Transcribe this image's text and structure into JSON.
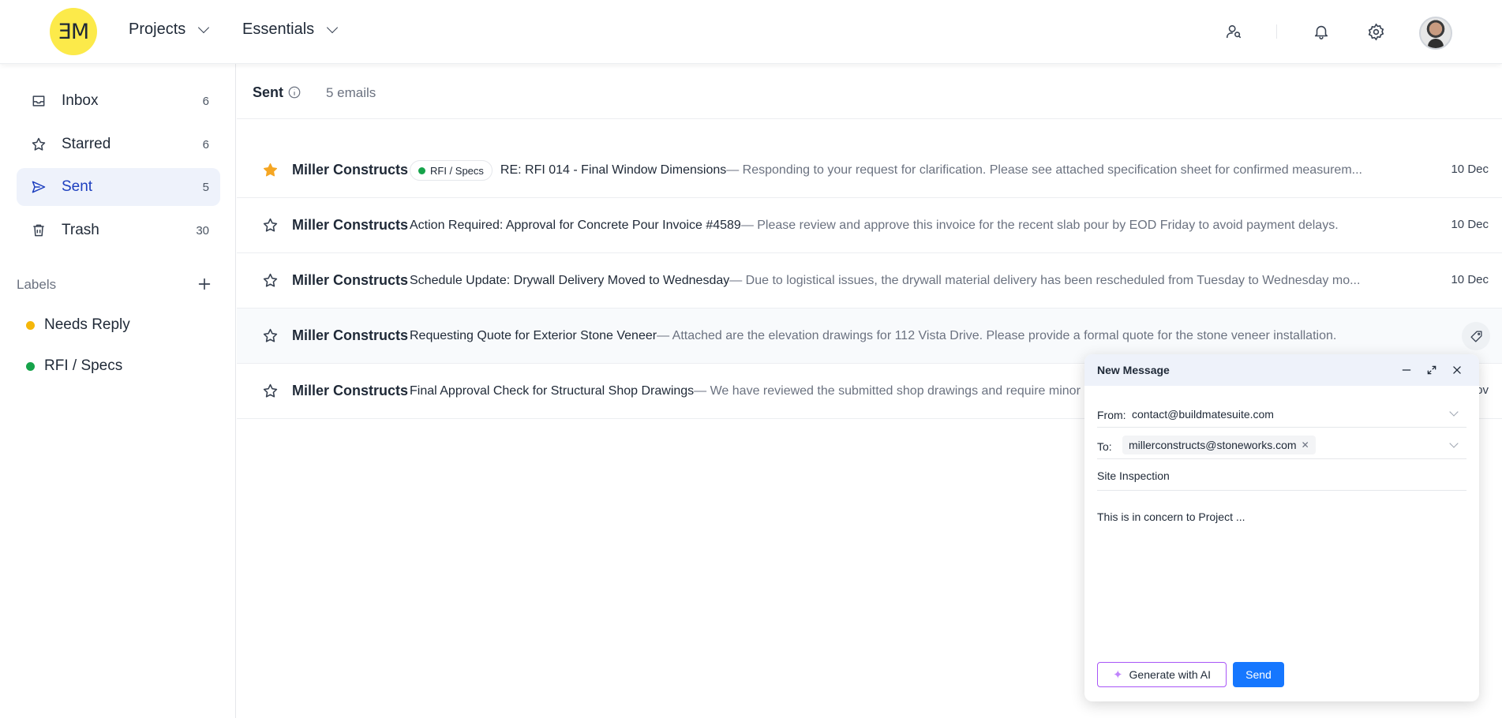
{
  "header": {
    "logo_text": "ƎM",
    "nav": [
      {
        "label": "Projects"
      },
      {
        "label": "Essentials"
      }
    ]
  },
  "sidebar": {
    "items": [
      {
        "label": "Inbox",
        "count": "6",
        "icon": "inbox-icon"
      },
      {
        "label": "Starred",
        "count": "6",
        "icon": "star-icon"
      },
      {
        "label": "Sent",
        "count": "5",
        "icon": "send-icon",
        "active": true
      },
      {
        "label": "Trash",
        "count": "30",
        "icon": "trash-icon"
      }
    ],
    "labels_heading": "Labels",
    "labels": [
      {
        "label": "Needs Reply",
        "color": "#f5b70a"
      },
      {
        "label": "RFI / Specs",
        "color": "#16a34a"
      }
    ]
  },
  "main": {
    "title": "Sent",
    "count_text": "5 emails",
    "emails": [
      {
        "sender": "Miller Constructs",
        "starred": true,
        "tag": "RFI / Specs",
        "tag_color": "#16a34a",
        "subject": "RE: RFI 014 - Final Window Dimensions",
        "snippet": " — Responding to your request for clarification. Please see attached specification sheet for confirmed measurem...",
        "date": "10 Dec"
      },
      {
        "sender": "Miller Constructs",
        "starred": false,
        "subject": "Action Required: Approval for Concrete Pour Invoice #4589",
        "snippet": " — Please review and approve this invoice for the recent slab pour by EOD Friday to avoid payment delays.",
        "date": "10 Dec"
      },
      {
        "sender": "Miller Constructs",
        "starred": false,
        "subject": "Schedule Update: Drywall Delivery Moved to Wednesday",
        "snippet": " — Due to logistical issues, the drywall material delivery has been rescheduled from Tuesday to Wednesday mo...",
        "date": "10 Dec"
      },
      {
        "sender": "Miller Constructs",
        "starred": false,
        "subject": "Requesting Quote for Exterior Stone Veneer",
        "snippet": " — Attached are the elevation drawings for 112 Vista Drive. Please provide a formal quote for the stone veneer installation.",
        "date": ""
      },
      {
        "sender": "Miller Constructs",
        "starred": false,
        "subject": "Final Approval Check for Structural Shop Drawings",
        "snippet": " — We have reviewed the submitted shop drawings and require minor",
        "date": "ov"
      }
    ]
  },
  "compose": {
    "title": "New Message",
    "from_label": "From:",
    "from_value": "contact@buildmatesuite.com",
    "to_label": "To:",
    "to_value": "millerconstructs@stoneworks.com",
    "subject_value": "Site Inspection",
    "body_value": "This is in concern to Project ...",
    "generate_label": "Generate with AI",
    "send_label": "Send"
  },
  "colors": {
    "accent": "#1677ff",
    "logo_bg": "#fcea4a",
    "active_nav_bg": "#eef2fb",
    "active_nav_text": "#1d3fbf",
    "star_filled": "#f5a623"
  }
}
